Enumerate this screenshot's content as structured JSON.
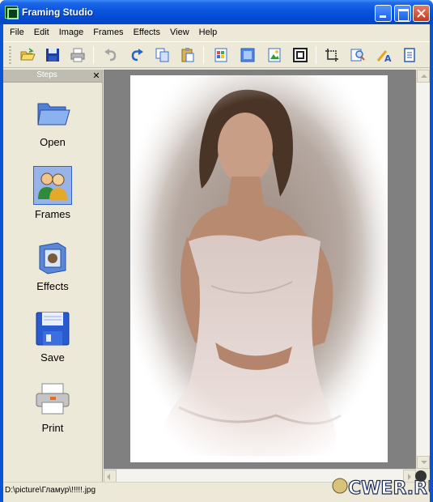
{
  "window": {
    "title": "Framing Studio"
  },
  "menu": [
    "File",
    "Edit",
    "Image",
    "Frames",
    "Effects",
    "View",
    "Help"
  ],
  "toolbar": [
    {
      "name": "open-icon"
    },
    {
      "name": "save-icon"
    },
    {
      "name": "print-icon"
    },
    {
      "name": "undo-icon"
    },
    {
      "name": "redo-icon"
    },
    {
      "name": "copy-icon"
    },
    {
      "name": "paste-icon"
    },
    {
      "name": "frames-icon"
    },
    {
      "name": "effects-icon"
    },
    {
      "name": "image-icon"
    },
    {
      "name": "border-icon"
    },
    {
      "name": "crop-icon"
    },
    {
      "name": "zoom-icon"
    },
    {
      "name": "text-icon"
    },
    {
      "name": "document-icon"
    }
  ],
  "steps": {
    "title": "Steps",
    "items": [
      {
        "label": "Open",
        "icon": "folder-icon",
        "selected": false
      },
      {
        "label": "Frames",
        "icon": "frames-people-icon",
        "selected": true
      },
      {
        "label": "Effects",
        "icon": "effects-box-icon",
        "selected": false
      },
      {
        "label": "Save",
        "icon": "floppy-icon",
        "selected": false
      },
      {
        "label": "Print",
        "icon": "printer-icon",
        "selected": false
      }
    ]
  },
  "status": {
    "path": "D:\\picture\\Гламур\\!!!!!.jpg"
  },
  "watermark": {
    "text": "CWER.RU"
  },
  "colors": {
    "titlebar": "#0855dd",
    "face": "#ece9d8",
    "canvas": "#808080",
    "selected": "#97b3e8"
  }
}
